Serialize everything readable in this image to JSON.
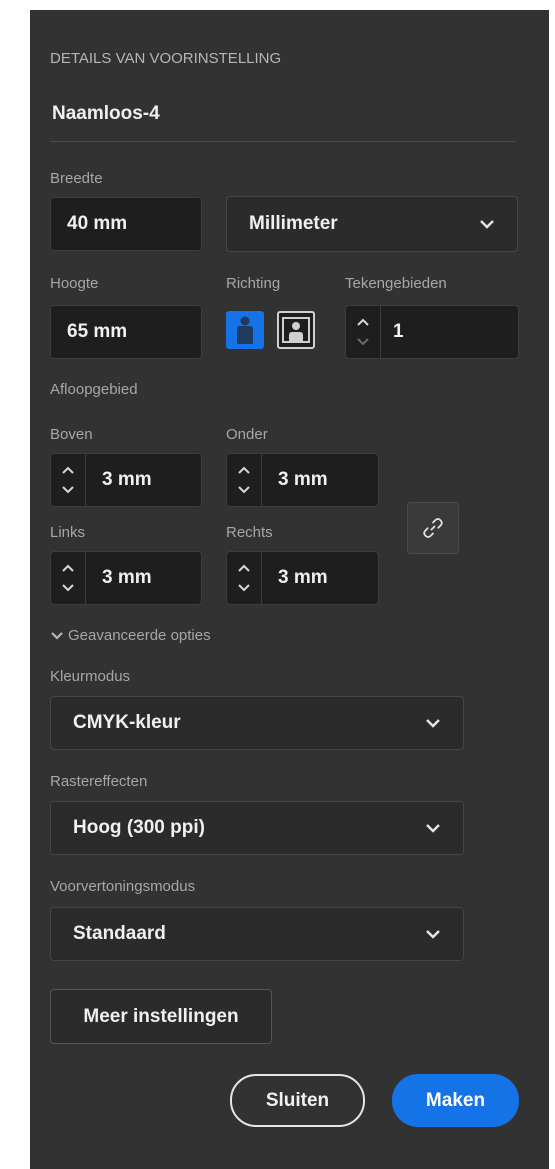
{
  "header": {
    "section_title": "DETAILS VAN VOORINSTELLING",
    "preset_name": "Naamloos-4"
  },
  "width": {
    "label": "Breedte",
    "value": "40 mm",
    "unit": "Millimeter"
  },
  "height": {
    "label": "Hoogte",
    "value": "65 mm"
  },
  "orientation": {
    "label": "Richting",
    "selected": "portrait"
  },
  "artboards": {
    "label": "Tekengebieden",
    "value": "1"
  },
  "bleed": {
    "label": "Afloopgebied",
    "top": {
      "label": "Boven",
      "value": "3 mm"
    },
    "bottom": {
      "label": "Onder",
      "value": "3 mm"
    },
    "left": {
      "label": "Links",
      "value": "3 mm"
    },
    "right": {
      "label": "Rechts",
      "value": "3 mm"
    },
    "linked_icon": "link-icon"
  },
  "advanced": {
    "toggle_label": "Geavanceerde opties",
    "color_mode": {
      "label": "Kleurmodus",
      "value": "CMYK-kleur"
    },
    "raster_effects": {
      "label": "Rastereffecten",
      "value": "Hoog (300 ppi)"
    },
    "preview_mode": {
      "label": "Voorvertoningsmodus",
      "value": "Standaard"
    }
  },
  "buttons": {
    "more_settings": "Meer instellingen",
    "close": "Sluiten",
    "create": "Maken"
  },
  "colors": {
    "panel_bg": "#323232",
    "accent": "#1473e6",
    "input_bg": "#1e1e1e"
  }
}
